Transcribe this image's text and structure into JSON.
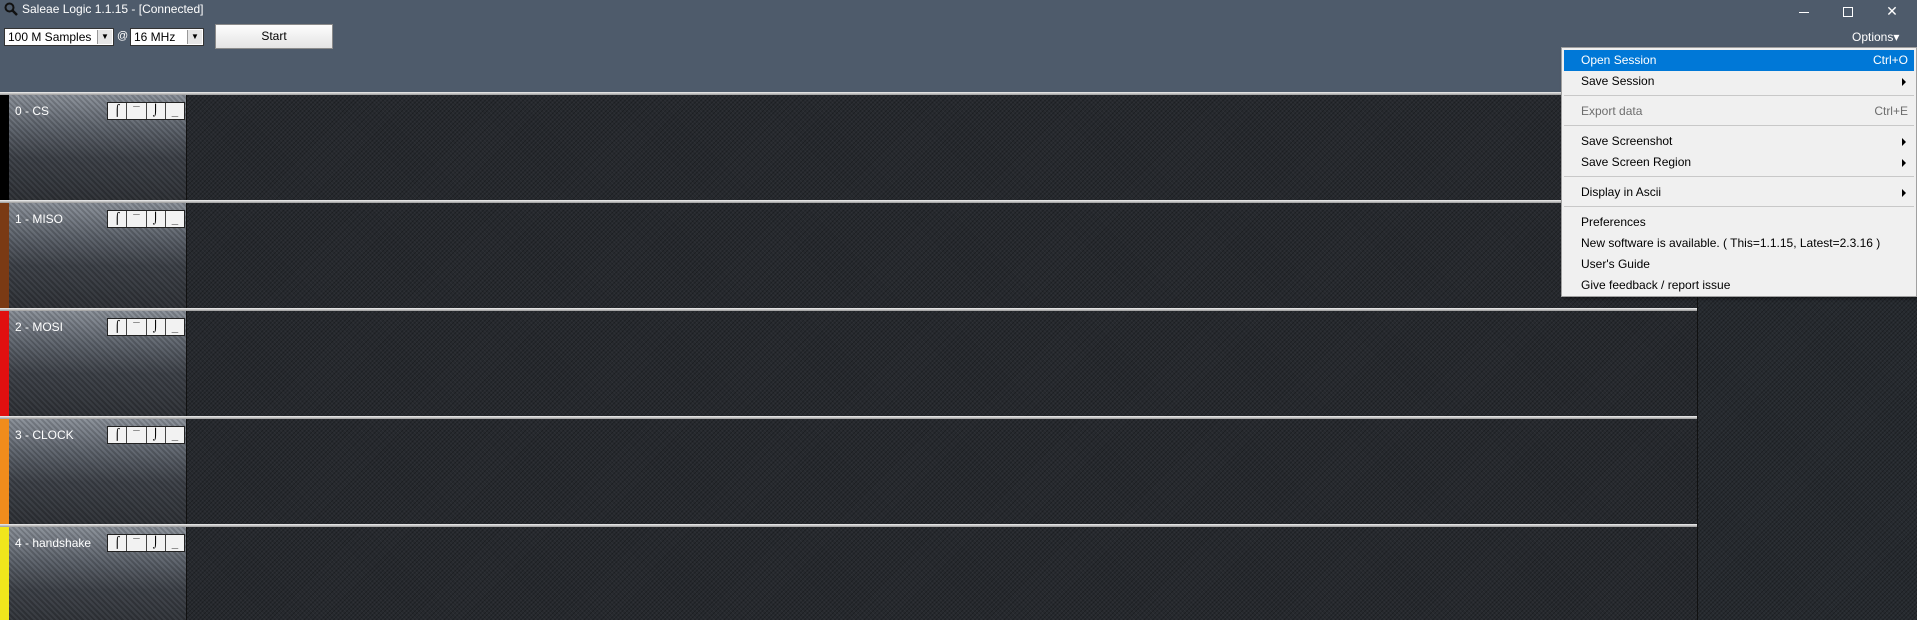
{
  "window": {
    "title": "Saleae Logic 1.1.15 - [Connected]",
    "minimize_label": "",
    "restore_label": "",
    "close_label": "✕"
  },
  "toolbar": {
    "samples_value": "100 M Samples",
    "at_label": "@",
    "rate_value": "16 MHz",
    "start_label": "Start",
    "options_label": "Options▾"
  },
  "trigger_glyphs": [
    "⌠",
    "‾",
    "⌡",
    "_"
  ],
  "channels": [
    {
      "name": "0 - CS",
      "color": "#000000"
    },
    {
      "name": "1 - MISO",
      "color": "#7a3a14"
    },
    {
      "name": "2 - MOSI",
      "color": "#e01010"
    },
    {
      "name": "3 - CLOCK",
      "color": "#f08c1c"
    },
    {
      "name": "4 - handshake",
      "color": "#f0e61c"
    }
  ],
  "menu": {
    "items": [
      {
        "label": "Open Session",
        "shortcut": "Ctrl+O"
      },
      {
        "label": "Save Session",
        "shortcut": ""
      },
      {
        "label": "Export data",
        "shortcut": "Ctrl+E"
      },
      {
        "label": "Save Screenshot",
        "shortcut": ""
      },
      {
        "label": "Save Screen Region",
        "shortcut": ""
      },
      {
        "label": "Display in Ascii",
        "shortcut": ""
      },
      {
        "label": "Preferences",
        "shortcut": ""
      },
      {
        "label": "New software is available. ( This=1.1.15, Latest=2.3.16 )",
        "shortcut": ""
      },
      {
        "label": "User's Guide",
        "shortcut": ""
      },
      {
        "label": "Give feedback / report issue",
        "shortcut": ""
      }
    ]
  },
  "colors": {
    "accent": "#0078d7",
    "background": "#4e5b6b"
  }
}
